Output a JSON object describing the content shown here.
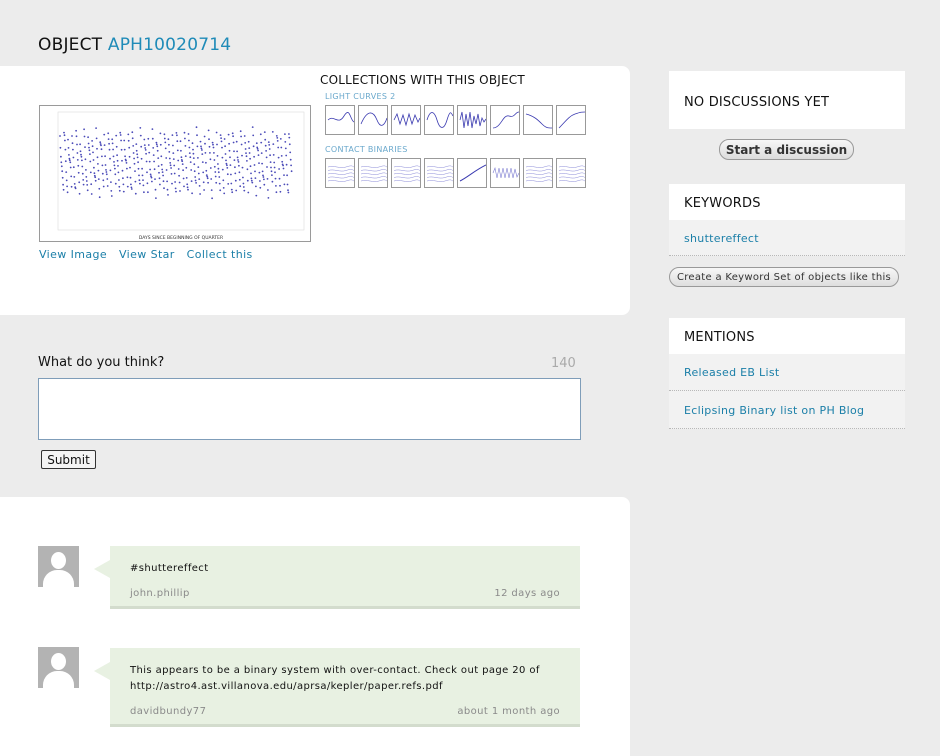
{
  "object": {
    "prefix": "OBJECT",
    "id": "APH10020714"
  },
  "lightcurve": {
    "x_label": "DAYS SINCE BEGINNING OF QUARTER",
    "links": [
      "View Image",
      "View Star",
      "Collect this"
    ]
  },
  "collections": {
    "title": "COLLECTIONS WITH THIS OBJECT",
    "groups": [
      {
        "name": "LIGHT CURVES 2",
        "thumb_count": 8
      },
      {
        "name": "CONTACT BINARIES",
        "thumb_count": 8
      }
    ]
  },
  "comment_form": {
    "label": "What do you think?",
    "remaining": "140",
    "value": "",
    "submit_label": "Submit"
  },
  "comments": [
    {
      "text": "#shuttereffect",
      "link": "",
      "author": "john.phillip",
      "time": "12 days ago"
    },
    {
      "text": "This appears to be a binary system with over-contact. Check out page 20 of",
      "link": "http://astro4.ast.villanova.edu/aprsa/kepler/paper.refs.pdf",
      "author": "davidbundy77",
      "time": "about 1 month ago"
    }
  ],
  "sidebar": {
    "discussions": {
      "title": "NO DISCUSSIONS YET",
      "button": "Start a discussion"
    },
    "keywords": {
      "title": "KEYWORDS",
      "items": [
        "shuttereffect"
      ],
      "button": "Create a Keyword Set of objects like this"
    },
    "mentions": {
      "title": "MENTIONS",
      "items": [
        "Released EB List",
        "Eclipsing Binary list on PH Blog"
      ]
    }
  },
  "colors": {
    "link": "#1b7fa8",
    "accent_id": "#1f8bb8",
    "bubble": "#e8f1e2",
    "page_bg": "#ececec"
  }
}
